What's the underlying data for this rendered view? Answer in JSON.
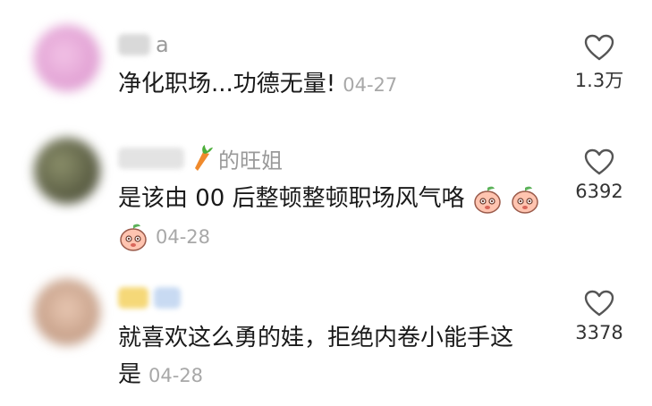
{
  "comments": [
    {
      "username_suffix": "a",
      "text": "净化职场...功德无量!",
      "date": "04-27",
      "likes": "1.3万",
      "avatar_color": "#e6a9d6"
    },
    {
      "username_suffix": "的旺姐",
      "badge_icon": "carrot-icon",
      "text": "是该由 00 后整顿整顿职场风气咯",
      "date": "04-28",
      "likes": "6392",
      "avatar_color": "#5d6147"
    },
    {
      "username_suffix": "",
      "text_line1": "就喜欢这么勇的娃，拒绝内卷小能手这",
      "text_line2": "是",
      "date": "04-28",
      "likes": "3378",
      "avatar_color": "#d9b39c"
    }
  ],
  "icons": {
    "like": "heart-outline-icon",
    "emoji": "peach-face-emoji-icon"
  },
  "colors": {
    "text": "#1a1a1a",
    "muted": "#a8a8a8"
  }
}
